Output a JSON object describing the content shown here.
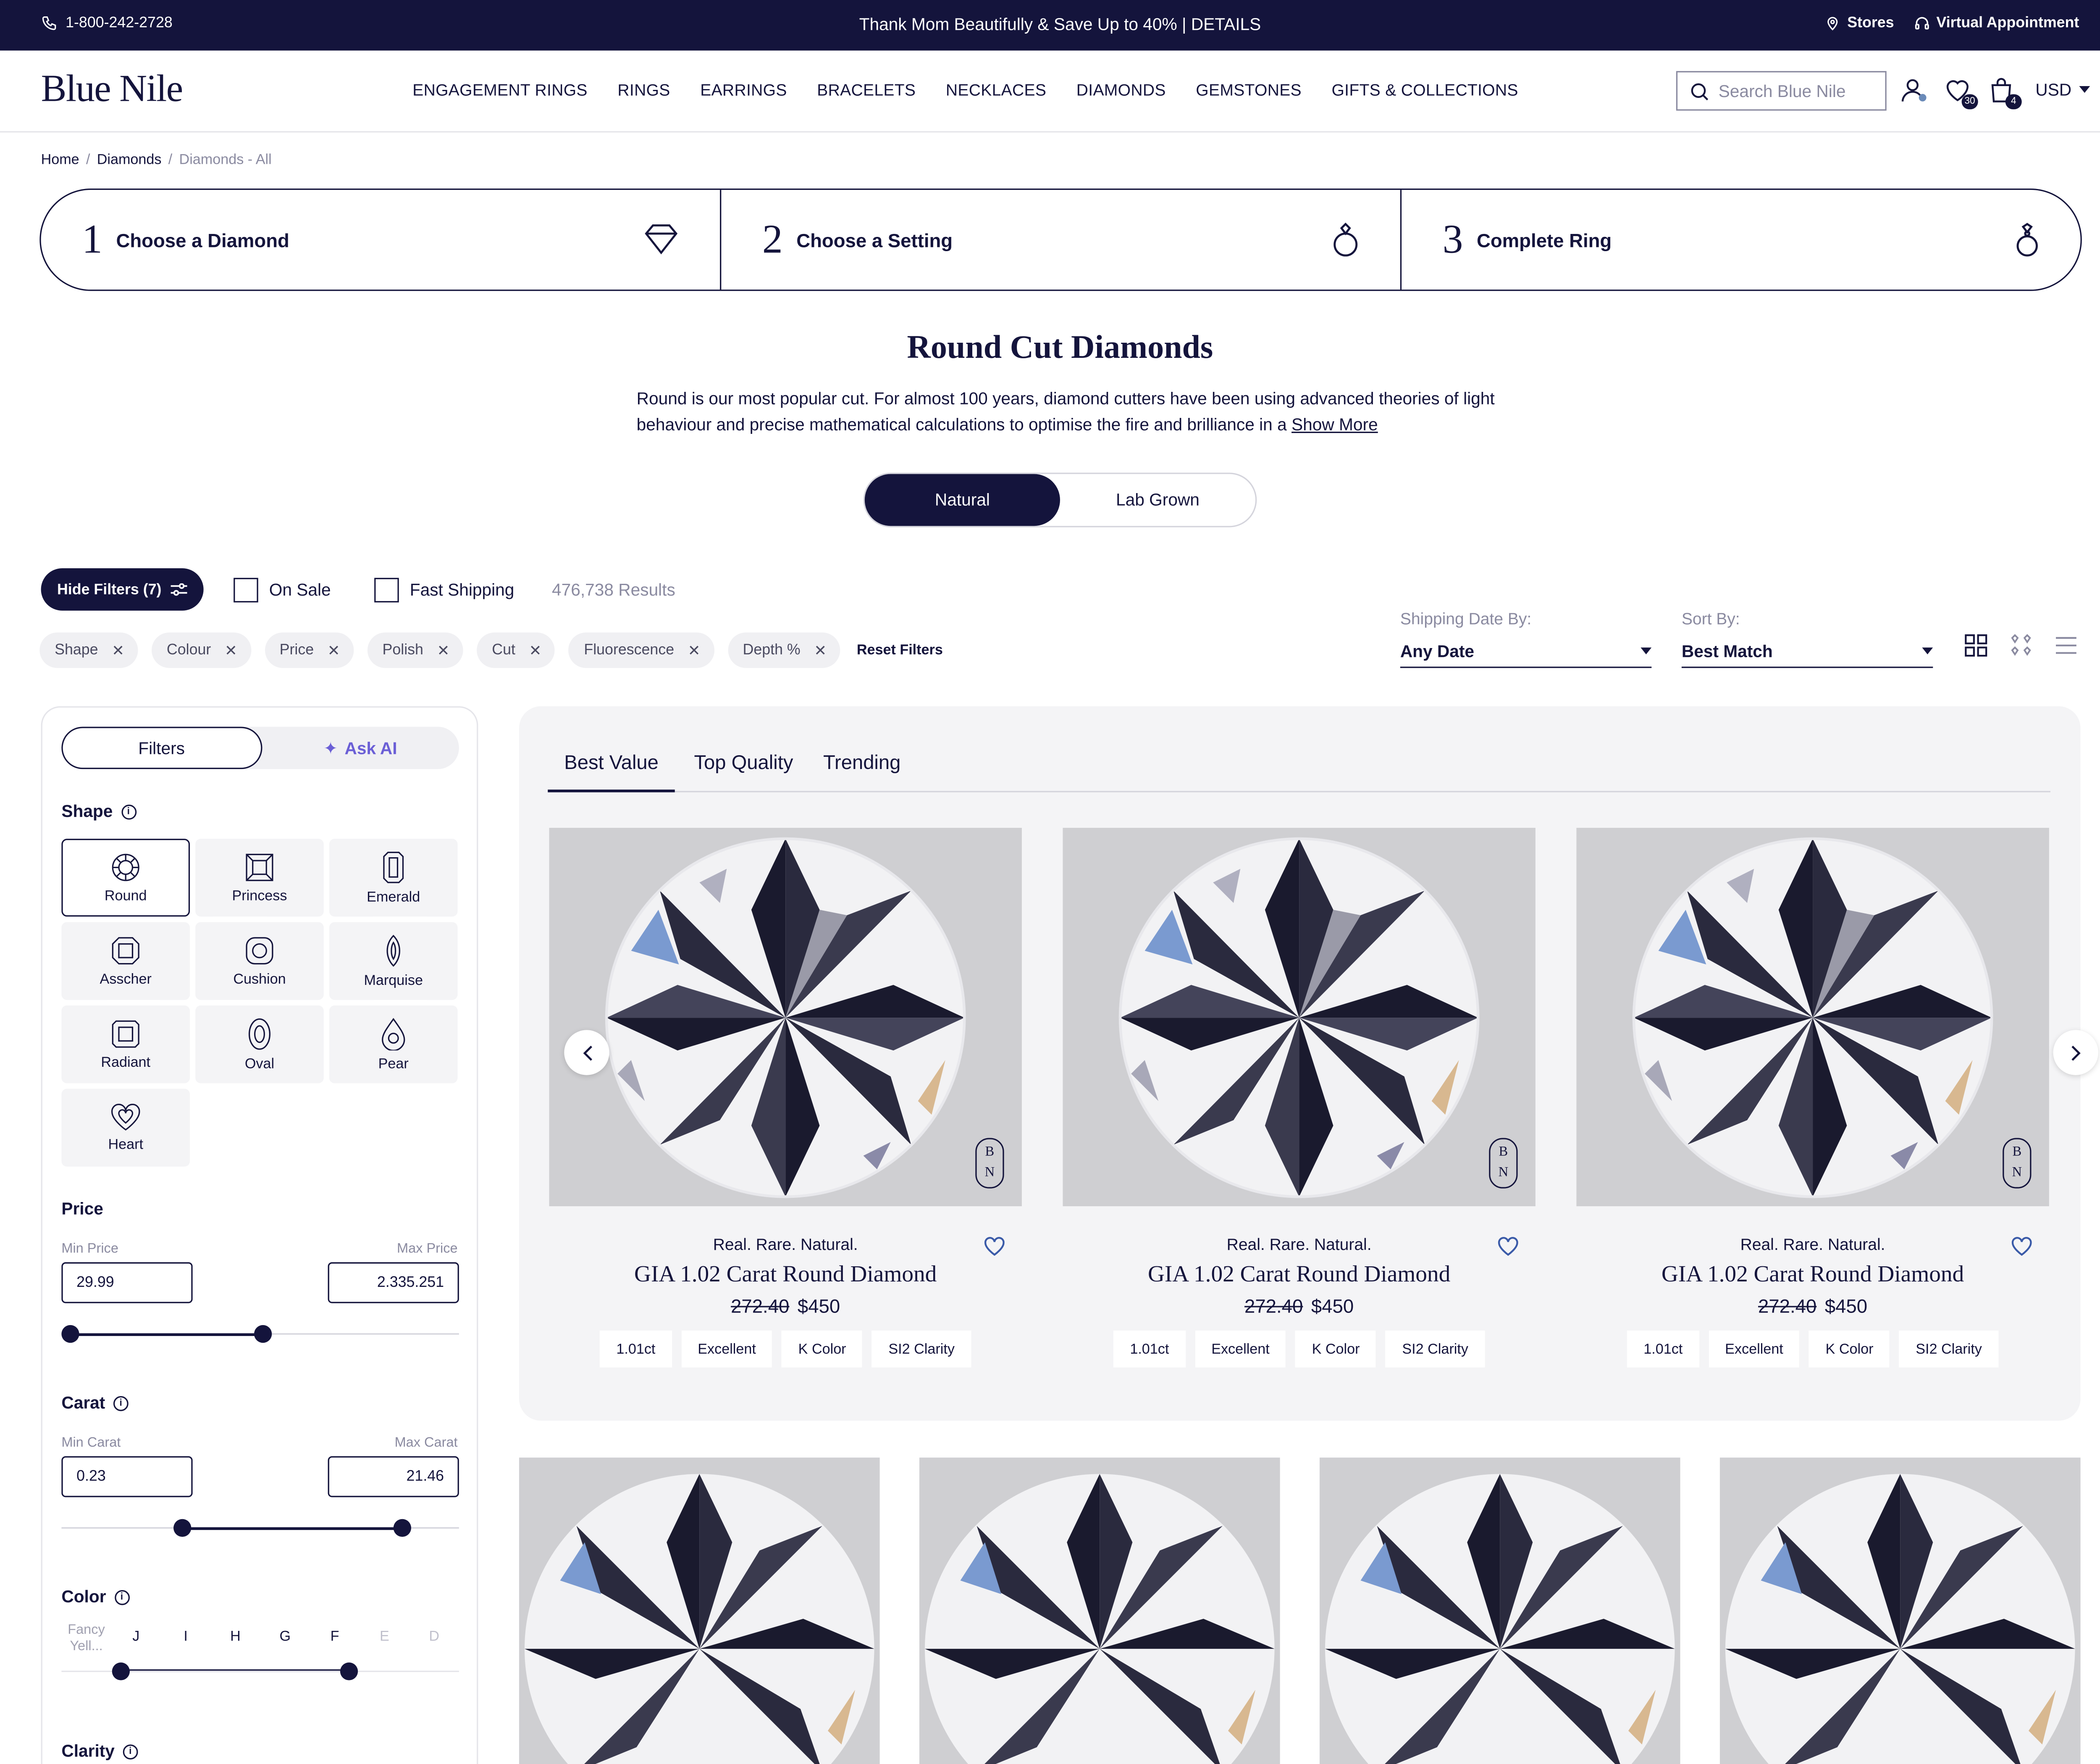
{
  "promo": {
    "phone": "1-800-242-2728",
    "message": "Thank Mom Beautifully & Save Up to 40% | DETAILS",
    "stores": "Stores",
    "virtual": "Virtual Appointment"
  },
  "header": {
    "logo": "Blue Nile",
    "nav": [
      "ENGAGEMENT RINGS",
      "RINGS",
      "EARRINGS",
      "BRACELETS",
      "NECKLACES",
      "DIAMONDS",
      "GEMSTONES",
      "GIFTS & COLLECTIONS"
    ],
    "search_placeholder": "Search Blue Nile",
    "wishlist_count": "30",
    "bag_count": "4",
    "currency": "USD"
  },
  "breadcrumb": {
    "home": "Home",
    "diamonds": "Diamonds",
    "current": "Diamonds - All"
  },
  "steps": [
    {
      "num": "1",
      "label": "Choose a Diamond"
    },
    {
      "num": "2",
      "label": "Choose a Setting"
    },
    {
      "num": "3",
      "label": "Complete Ring"
    }
  ],
  "intro": {
    "title": "Round Cut Diamonds",
    "description": "Round is our most popular cut. For almost 100 years, diamond cutters have been using advanced theories of light behaviour and precise mathematical calculations to optimise the fire and brilliance in a",
    "show_more": "Show More"
  },
  "origin_toggle": {
    "natural": "Natural",
    "lab": "Lab Grown"
  },
  "filterbar": {
    "hide_filters": "Hide Filters (7)",
    "on_sale": "On Sale",
    "fast_shipping": "Fast Shipping",
    "results": "476,738 Results",
    "chips": [
      "Shape",
      "Colour",
      "Price",
      "Polish",
      "Cut",
      "Fluorescence",
      "Depth %"
    ],
    "reset": "Reset Filters",
    "shipping_label": "Shipping Date By:",
    "shipping_value": "Any Date",
    "sort_label": "Sort By:",
    "sort_value": "Best Match"
  },
  "sidebar": {
    "tab_filters": "Filters",
    "tab_ai": "Ask AI",
    "shape_title": "Shape",
    "shapes": [
      "Round",
      "Princess",
      "Emerald",
      "Asscher",
      "Cushion",
      "Marquise",
      "Radiant",
      "Oval",
      "Pear",
      "Heart"
    ],
    "price_title": "Price",
    "min_price_label": "Min Price",
    "max_price_label": "Max Price",
    "min_price": "29.99",
    "max_price": "2.335.251",
    "carat_title": "Carat",
    "min_carat_label": "Min Carat",
    "max_carat_label": "Max Carat",
    "min_carat": "0.23",
    "max_carat": "21.46",
    "color_title": "Color",
    "color_grades": [
      "Fancy Yell...",
      "J",
      "I",
      "H",
      "G",
      "F",
      "E",
      "D"
    ],
    "clarity_title": "Clarity"
  },
  "featured": {
    "tabs": [
      "Best Value",
      "Top Quality",
      "Trending"
    ],
    "cards": [
      {
        "tag": "Real. Rare. Natural.",
        "title": "GIA 1.02 Carat Round Diamond",
        "old_price": "272.40",
        "price": "$450",
        "specs": [
          "1.01ct",
          "Excellent",
          "K Color",
          "SI2 Clarity"
        ]
      },
      {
        "tag": "Real. Rare. Natural.",
        "title": "GIA 1.02 Carat Round Diamond",
        "old_price": "272.40",
        "price": "$450",
        "specs": [
          "1.01ct",
          "Excellent",
          "K Color",
          "SI2 Clarity"
        ]
      },
      {
        "tag": "Real. Rare. Natural.",
        "title": "GIA 1.02 Carat Round Diamond",
        "old_price": "272.40",
        "price": "$450",
        "specs": [
          "1.01ct",
          "Excellent",
          "K Color",
          "SI2 Clarity"
        ]
      }
    ]
  },
  "icons": {
    "phone": "phone-icon",
    "pin": "location-pin-icon",
    "headset": "headset-icon",
    "search": "search-icon",
    "account": "account-icon",
    "heart": "heart-icon",
    "bag": "bag-icon"
  },
  "colors": {
    "brand": "#14143c",
    "ai": "#6b5fd6"
  }
}
